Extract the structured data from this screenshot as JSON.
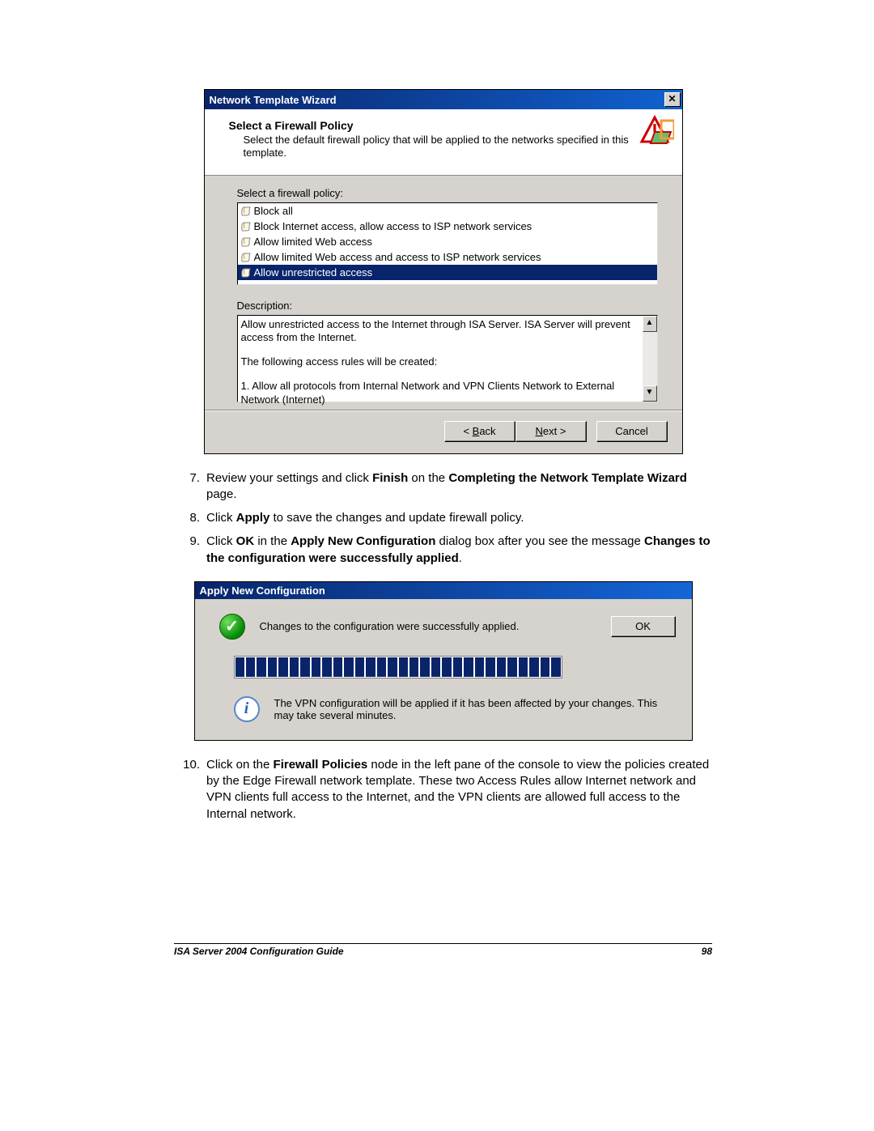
{
  "wizard": {
    "title": "Network Template Wizard",
    "head_title": "Select a Firewall Policy",
    "head_desc": "Select the default firewall policy that will be applied to the networks specified in this template.",
    "list_label": "Select a firewall policy:",
    "items": [
      "Block all",
      "Block Internet access, allow access to ISP network services",
      "Allow limited Web access",
      "Allow limited Web access and access to ISP network services",
      "Allow unrestricted access"
    ],
    "selected_index": 4,
    "desc_label": "Description:",
    "desc_line1": "Allow unrestricted access to the Internet through ISA Server. ISA Server will prevent access from the Internet.",
    "desc_line2": "The following access rules will be created:",
    "desc_line3": "1. Allow all protocols from Internal Network and VPN Clients Network to External Network (Internet)",
    "btn_back": "< Back",
    "btn_next": "Next >",
    "btn_cancel": "Cancel"
  },
  "instructions": {
    "i7_pre": "Review your settings and click ",
    "i7_b1": "Finish",
    "i7_mid": " on the ",
    "i7_b2": "Completing the Network Template Wizard",
    "i7_post": " page.",
    "i8_pre": "Click ",
    "i8_b1": "Apply",
    "i8_post": " to save the changes and update firewall policy.",
    "i9_pre": "Click ",
    "i9_b1": "OK",
    "i9_mid": " in the ",
    "i9_b2": "Apply New Configuration",
    "i9_mid2": " dialog box after you see the message ",
    "i9_b3": "Changes to the configuration were successfully applied",
    "i9_post": ".",
    "i10_pre": "Click on the ",
    "i10_b1": "Firewall Policies",
    "i10_post": " node in the left pane of the console to view the policies created by the Edge Firewall network template. These two Access Rules allow Internet network and VPN clients full access to the Internet, and the VPN clients are allowed full access to the Internal network."
  },
  "apply": {
    "title": "Apply New Configuration",
    "msg1": "Changes to the configuration were successfully applied.",
    "ok": "OK",
    "msg2": "The VPN configuration will be applied if it has been affected by your changes. This may take several minutes."
  },
  "footer": {
    "left": "ISA Server 2004 Configuration Guide",
    "right": "98"
  }
}
